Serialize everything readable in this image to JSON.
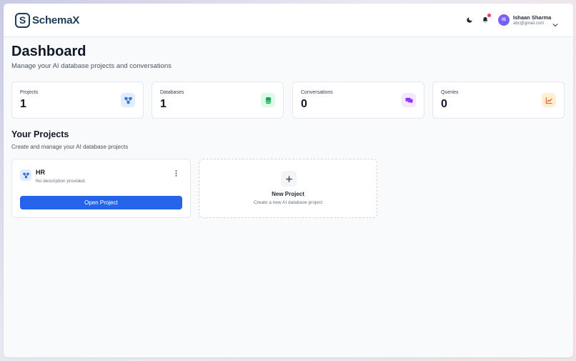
{
  "header": {
    "brand": "SchemaX",
    "logo_letter": "S",
    "theme_toggle_icon": "moon-icon",
    "notification_icon": "bell-icon",
    "user": {
      "initials": "IS",
      "name": "Ishaan Sharma",
      "email": "abc@gmail.com"
    }
  },
  "page": {
    "title": "Dashboard",
    "subtitle": "Manage your AI database projects and conversations"
  },
  "stats": [
    {
      "label": "Projects",
      "value": "1",
      "icon": "project-network-icon",
      "bg": "#e0ecff",
      "color": "#3b6fd8"
    },
    {
      "label": "Databases",
      "value": "1",
      "icon": "database-icon",
      "bg": "#dcfce7",
      "color": "#16a34a"
    },
    {
      "label": "Conversations",
      "value": "0",
      "icon": "chat-icon",
      "bg": "#f3e8ff",
      "color": "#9333ea"
    },
    {
      "label": "Queries",
      "value": "0",
      "icon": "chart-icon",
      "bg": "#ffedd5",
      "color": "#ea580c"
    }
  ],
  "projects_section": {
    "title": "Your Projects",
    "subtitle": "Create and manage your AI database projects",
    "projects": [
      {
        "name": "HR",
        "description": "No description provided.",
        "open_label": "Open Project"
      }
    ],
    "new_project": {
      "title": "New Project",
      "subtitle": "Create a new AI database project"
    }
  },
  "colors": {
    "accent": "#2563eb",
    "brand": "#1f3b57",
    "notification_dot": "#ef4444"
  }
}
